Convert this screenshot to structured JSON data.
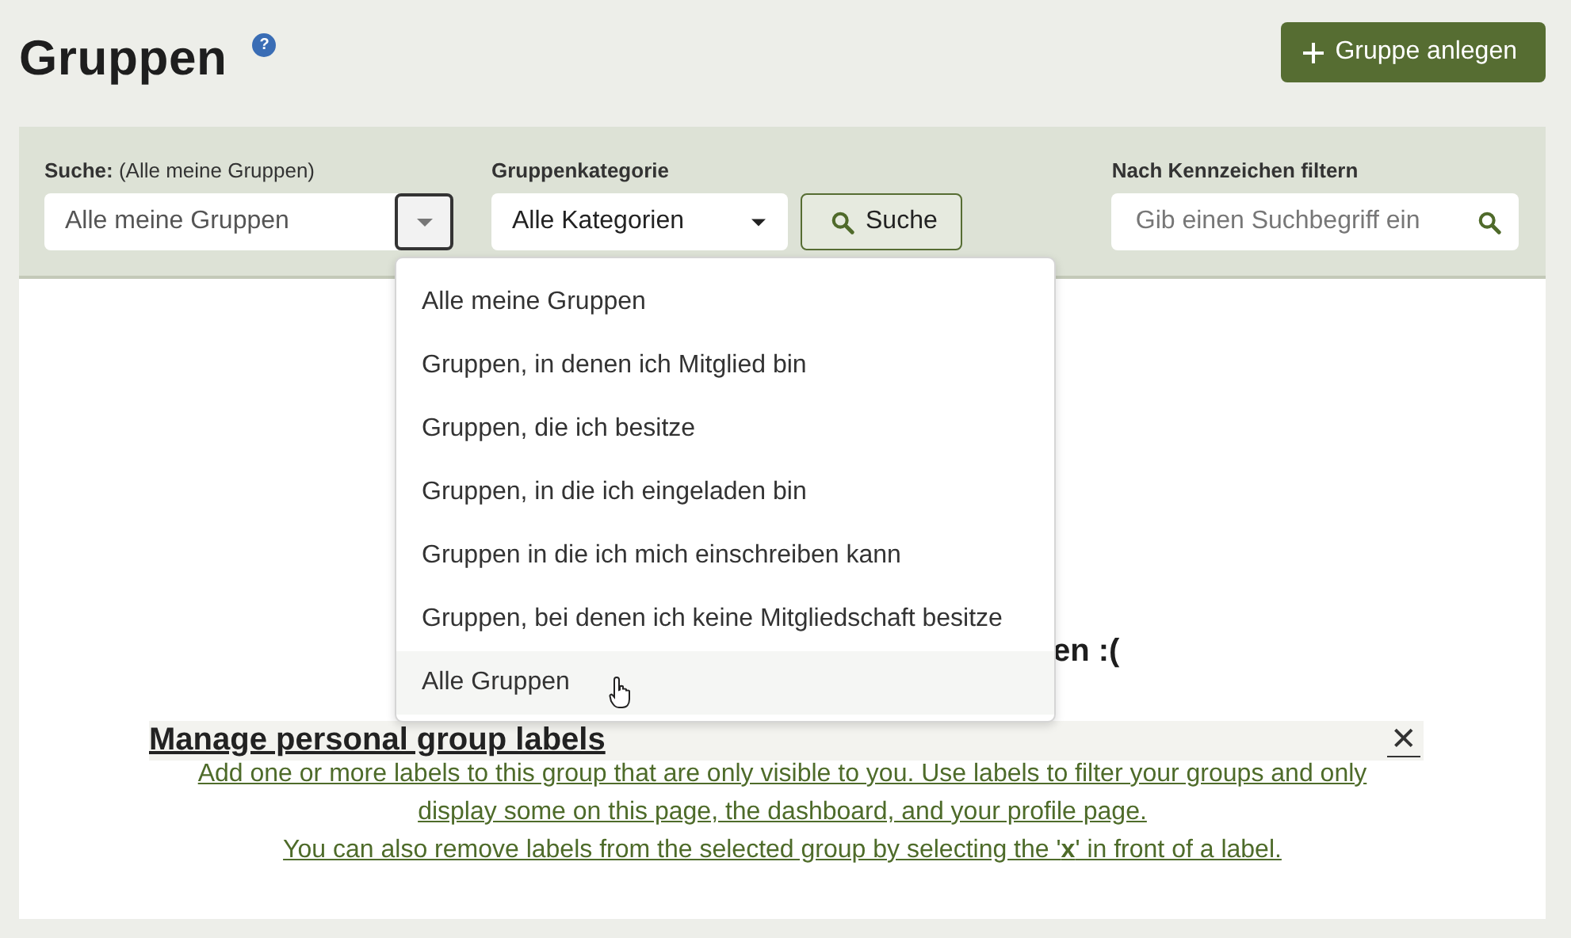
{
  "header": {
    "title": "Gruppen",
    "help_icon": "?",
    "new_button": "Gruppe anlegen"
  },
  "filters": {
    "search_label": "**Suche:** (Alle meine Gruppen)",
    "scope_value": "Alle meine Gruppen",
    "scope_expanded": true,
    "category_label": "Gruppenkategorie",
    "category_value": "Alle Kategorien",
    "search_button": "Suche",
    "tag_label": "Nach Kennzeichen filtern",
    "tag_placeholder": "Gib einen Suchbegriff ein"
  },
  "scope_menu": [
    {
      "label": "Alle meine Gruppen",
      "highlighted": false
    },
    {
      "label": "Gruppen, in denen ich Mitglied bin",
      "highlighted": false
    },
    {
      "label": "Gruppen, die ich besitze",
      "highlighted": false
    },
    {
      "label": "Gruppen, in die ich eingeladen bin",
      "highlighted": false
    },
    {
      "label": "Gruppen in die ich mich einschreiben kann",
      "highlighted": false
    },
    {
      "label": "Gruppen, bei denen ich keine Mitgliedschaft besitze",
      "highlighted": false
    },
    {
      "label": "Alle Gruppen",
      "highlighted": true
    }
  ],
  "empty_message": "en :(",
  "labels_panel": {
    "title": "Manage personal group labels",
    "close": "✕",
    "description": "Add one or more labels to this group that are only visible to you. Use labels to filter your groups and only display some on this page, the dashboard, and your profile page.",
    "remove_hint": "You can also remove labels from the selected group by selecting the '**x**' in front of a label."
  }
}
